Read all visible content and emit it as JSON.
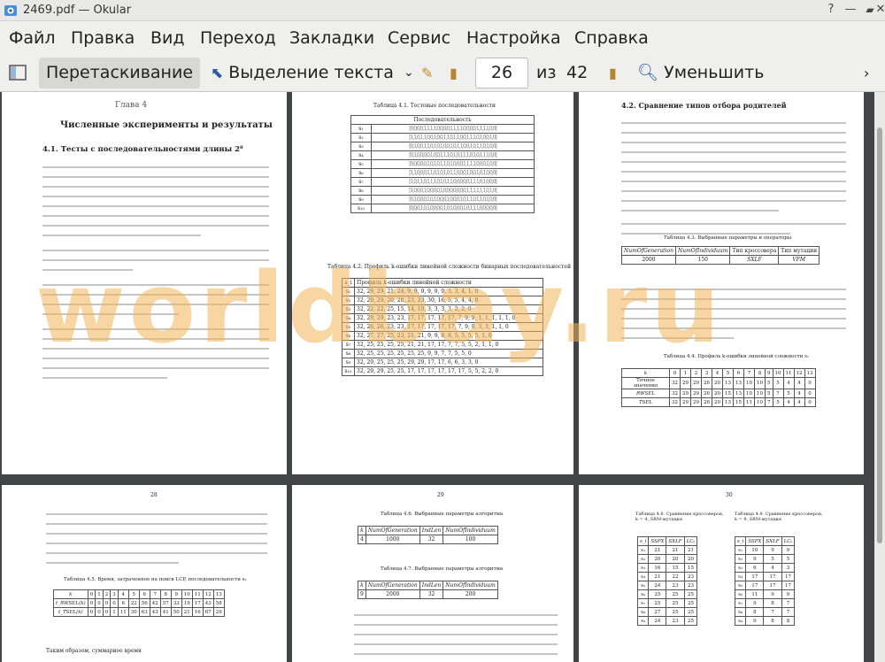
{
  "window": {
    "title": "2469.pdf — Okular"
  },
  "menu": [
    "Файл",
    "Правка",
    "Вид",
    "Переход",
    "Закладки",
    "Сервис",
    "Настройка",
    "Справка"
  ],
  "toolbar": {
    "drag_label": "Перетаскивание",
    "select_label": "Выделение текста",
    "page_value": "26",
    "of_label": "из",
    "total_pages": "42",
    "zoom_out_label": "Уменьшить"
  },
  "watermark": "worldbay.ru",
  "pages": {
    "p1": {
      "chapter": "Глава 4",
      "chapter_title": "Численные эксперименты и результаты",
      "section": "4.1. Тесты с последовательностями длины 2⁸"
    },
    "p2": {
      "caption1": "Таблица 4.1. Тестовые последовательности",
      "col_header": "Последовательность",
      "rows": [
        "s₁",
        "s₂",
        "s₃",
        "s₄",
        "s₅",
        "s₆",
        "s₇",
        "s₈",
        "s₉",
        "s₁₀"
      ],
      "caption2": "Таблица 4.2. Профиль k-ошибки линейной сложности бинарных последовательностей",
      "profile_header": "Профиль k-ошибки линейной сложности",
      "profiles": [
        "32, 29, 29, 21, 24, 9, 9, 9, 9, 9, 9, 3, 3, 4, 1, 0",
        "32, 29, 29, 20, 20, 23, 23, 30, 16, 5, 5, 4, 4, 0",
        "32, 22, 22, 25, 15, 14, 10, 3, 3, 3, 3, 2, 2, 0",
        "32, 29, 29, 23, 23, 17, 17, 17, 17, 17, 7, 9, 9, 1, 1, 1, 1, 1, 0",
        "32, 26, 26, 23, 23, 17, 17, 17, 17, 17, 7, 9, 9, 3, 3, 1, 1, 0",
        "32, 27, 27, 25, 23, 21, 21, 9, 9, 8, 8, 5, 5, 5, 5, 1, 0",
        "32, 25, 25, 25, 25, 21, 21, 17, 17, 7, 7, 5, 5, 2, 1, 1, 0",
        "32, 25, 25, 25, 25, 25, 25, 9, 9, 7, 7, 5, 5, 0",
        "32, 29, 25, 25, 25, 29, 29, 17, 17, 6, 6, 3, 3, 0",
        "32, 29, 29, 25, 25, 17, 17, 17, 17, 17, 17, 5, 5, 2, 2, 0"
      ]
    },
    "p3": {
      "section": "4.2. Сравнение типов отбора родителей",
      "caption_params": "Таблица 4.3. Выбранные параметры и операторы",
      "params_headers": [
        "NumOfGeneration",
        "NumOfIndividuum",
        "Тип кроссовера",
        "Тип мутации"
      ],
      "params_values": [
        "2000",
        "150",
        "SXLF",
        "VFM"
      ],
      "caption_profile": "Таблица 4.4. Профиль k-ошибки линейной сложности s₁",
      "k_headers": [
        "k",
        "0",
        "1",
        "2",
        "3",
        "4",
        "5",
        "6",
        "7",
        "8",
        "9",
        "10",
        "11",
        "12",
        "13"
      ],
      "k_rows": [
        {
          "label": "Точное значение",
          "vals": [
            "32",
            "29",
            "29",
            "26",
            "20",
            "13",
            "13",
            "10",
            "10",
            "5",
            "5",
            "4",
            "4",
            "0"
          ]
        },
        {
          "label": "RWSEL",
          "vals": [
            "32",
            "29",
            "29",
            "26",
            "20",
            "15",
            "13",
            "10",
            "10",
            "5",
            "7",
            "5",
            "4",
            "0"
          ]
        },
        {
          "label": "TSEL",
          "vals": [
            "32",
            "29",
            "29",
            "26",
            "20",
            "13",
            "15",
            "11",
            "10",
            "7",
            "5",
            "4",
            "4",
            "0"
          ]
        }
      ]
    },
    "p4": {
      "page_num": "28",
      "caption": "Таблица 4.5. Время, затраченное на поиск LCP, последовательности s₂",
      "k_headers": [
        "k",
        "0",
        "1",
        "2",
        "3",
        "4",
        "5",
        "6",
        "7",
        "8",
        "9",
        "10",
        "11",
        "12",
        "13"
      ],
      "rows": [
        {
          "label": "t_RWSEL(k)",
          "vals": [
            "0",
            "0",
            "0",
            "0",
            "6",
            "22",
            "56",
            "42",
            "57",
            "33",
            "19",
            "17",
            "43",
            "58"
          ]
        },
        {
          "label": "t_TSEL(k)",
          "vals": [
            "0",
            "0",
            "0",
            "1",
            "11",
            "30",
            "63",
            "43",
            "41",
            "50",
            "21",
            "16",
            "67",
            "29"
          ]
        }
      ],
      "tail": "Таким образом, суммарное время"
    },
    "p5": {
      "page_num": "29",
      "caption1": "Таблица 4.6. Выбранные параметры алгоритма",
      "t1_headers": [
        "k",
        "NumOfGeneration",
        "IndLen",
        "NumOfIndividuum"
      ],
      "t1_values": [
        "4",
        "1000",
        "32",
        "100"
      ],
      "caption2": "Таблица 4.7. Выбранные параметры алгоритма",
      "t2_headers": [
        "k",
        "NumOfGeneration",
        "IndLen",
        "NumOfIndividuum"
      ],
      "t2_values": [
        "9",
        "2000",
        "32",
        "200"
      ]
    },
    "p6": {
      "page_num": "30",
      "caption_a": "Таблица 4.8. Сравнение кроссоверов, k = 4, SRM-мутация",
      "caption_b": "Таблица 4.9. Сравнение кроссоверов, k = 9, SRM-мутация",
      "headers": [
        "s_i",
        "SSPX",
        "SXLF",
        "LCₖ"
      ],
      "table_a": [
        [
          "s₁",
          "21",
          "21",
          "21"
        ],
        [
          "s₂",
          "20",
          "20",
          "20"
        ],
        [
          "s₃",
          "16",
          "15",
          "15"
        ],
        [
          "s₄",
          "21",
          "22",
          "23"
        ],
        [
          "s₅",
          "24",
          "23",
          "23"
        ],
        [
          "s₆",
          "25",
          "25",
          "25"
        ],
        [
          "s₇",
          "25",
          "25",
          "25"
        ],
        [
          "s₈",
          "27",
          "25",
          "25"
        ],
        [
          "s₉",
          "24",
          "23",
          "25"
        ]
      ],
      "table_b": [
        [
          "s₁",
          "10",
          "9",
          "9"
        ],
        [
          "s₂",
          "9",
          "5",
          "5"
        ],
        [
          "s₃",
          "6",
          "4",
          "3"
        ],
        [
          "s₄",
          "17",
          "17",
          "17"
        ],
        [
          "s₅",
          "17",
          "17",
          "17"
        ],
        [
          "s₆",
          "11",
          "9",
          "9"
        ],
        [
          "s₇",
          "9",
          "8",
          "7"
        ],
        [
          "s₈",
          "8",
          "7",
          "7"
        ],
        [
          "s₉",
          "9",
          "8",
          "8"
        ]
      ]
    }
  }
}
